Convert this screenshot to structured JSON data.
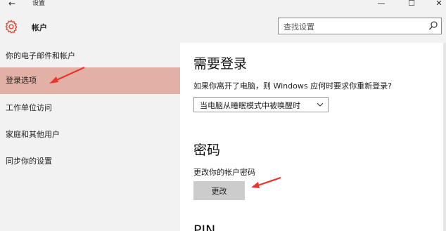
{
  "window": {
    "title": "设置",
    "back_glyph": "←",
    "minimize_glyph": "—",
    "maximize_glyph": "☐",
    "close_glyph": "✕"
  },
  "header": {
    "icon": "gear-icon",
    "title": "帐户",
    "search": {
      "placeholder": "查找设置",
      "icon": "search-icon"
    }
  },
  "sidebar": {
    "items": [
      {
        "label": "你的电子邮件和帐户",
        "active": false
      },
      {
        "label": "登录选项",
        "active": true
      },
      {
        "label": "工作单位访问",
        "active": false
      },
      {
        "label": "家庭和其他用户",
        "active": false
      },
      {
        "label": "同步你的设置",
        "active": false
      }
    ]
  },
  "main": {
    "require_signin": {
      "heading": "需要登录",
      "description": "如果你离开了电脑，则 Windows 应何时要求你重新登录?",
      "dropdown_value": "当电脑从睡眠模式中被唤醒时"
    },
    "password": {
      "heading": "密码",
      "description": "更改你的帐户密码",
      "button_label": "更改"
    },
    "pin": {
      "heading": "PIN"
    }
  },
  "colors": {
    "active_highlight": "#e3b0a5",
    "annotation_arrow": "#e8362e",
    "accent_icon": "#d9513a"
  }
}
